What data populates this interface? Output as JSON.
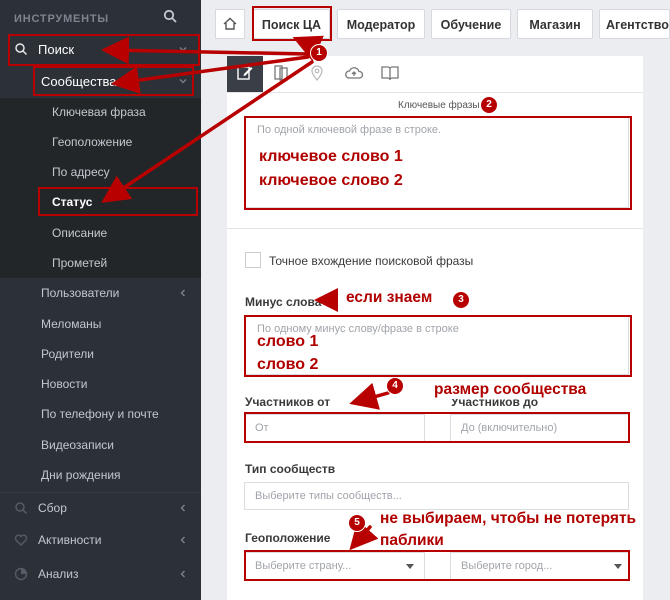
{
  "sidebar": {
    "header": "ИНСТРУМЕНТЫ",
    "search_label": "Поиск",
    "communities_label": "Сообщества",
    "sub_items": [
      "Ключевая фраза",
      "Геоположение",
      "По адресу",
      "Статус",
      "Описание",
      "Прометей"
    ],
    "other_items": [
      "Пользователи",
      "Меломаны",
      "Родители",
      "Новости",
      "По телефону и почте",
      "Видеозаписи",
      "Дни рождения"
    ],
    "bottom_items": [
      "Сбор",
      "Активности",
      "Анализ"
    ]
  },
  "tabs": [
    "Поиск ЦА",
    "Модератор",
    "Обучение",
    "Магазин",
    "Агентство"
  ],
  "toolbar_icons": [
    "edit-icon",
    "copy-icon",
    "location-icon",
    "cloud-upload-icon",
    "book-icon"
  ],
  "form": {
    "keywords_caption": "Ключевые фразы",
    "keywords_placeholder": "По одной ключевой фразе в строке.",
    "keywords_lines": [
      "ключевое слово 1",
      "ключевое слово 2"
    ],
    "exact_match_label": "Точное вхождение поисковой фразы",
    "minus_label": "Минус слова",
    "minus_placeholder": "По одному минус слову/фразе в строке",
    "minus_lines": [
      "слово 1",
      "слово 2"
    ],
    "members_from_label": "Участников от",
    "members_to_label": "Участников до",
    "members_from_placeholder": "От",
    "members_to_placeholder": "До (включительно)",
    "community_type_label": "Тип сообществ",
    "community_type_placeholder": "Выберите типы сообществ...",
    "geo_label": "Геоположение",
    "country_placeholder": "Выберите страну...",
    "city_placeholder": "Выберите город..."
  },
  "annotations": {
    "badges": [
      "1",
      "2",
      "3",
      "4",
      "5"
    ],
    "if_known": "если знаем",
    "community_size": "размер сообщества",
    "dont_choose_line1": "не выбираем, чтобы не потерять",
    "dont_choose_line2": "паблики"
  },
  "colors": {
    "sidebar_bg": "#2c3037",
    "annotation_red": "#b90000"
  }
}
